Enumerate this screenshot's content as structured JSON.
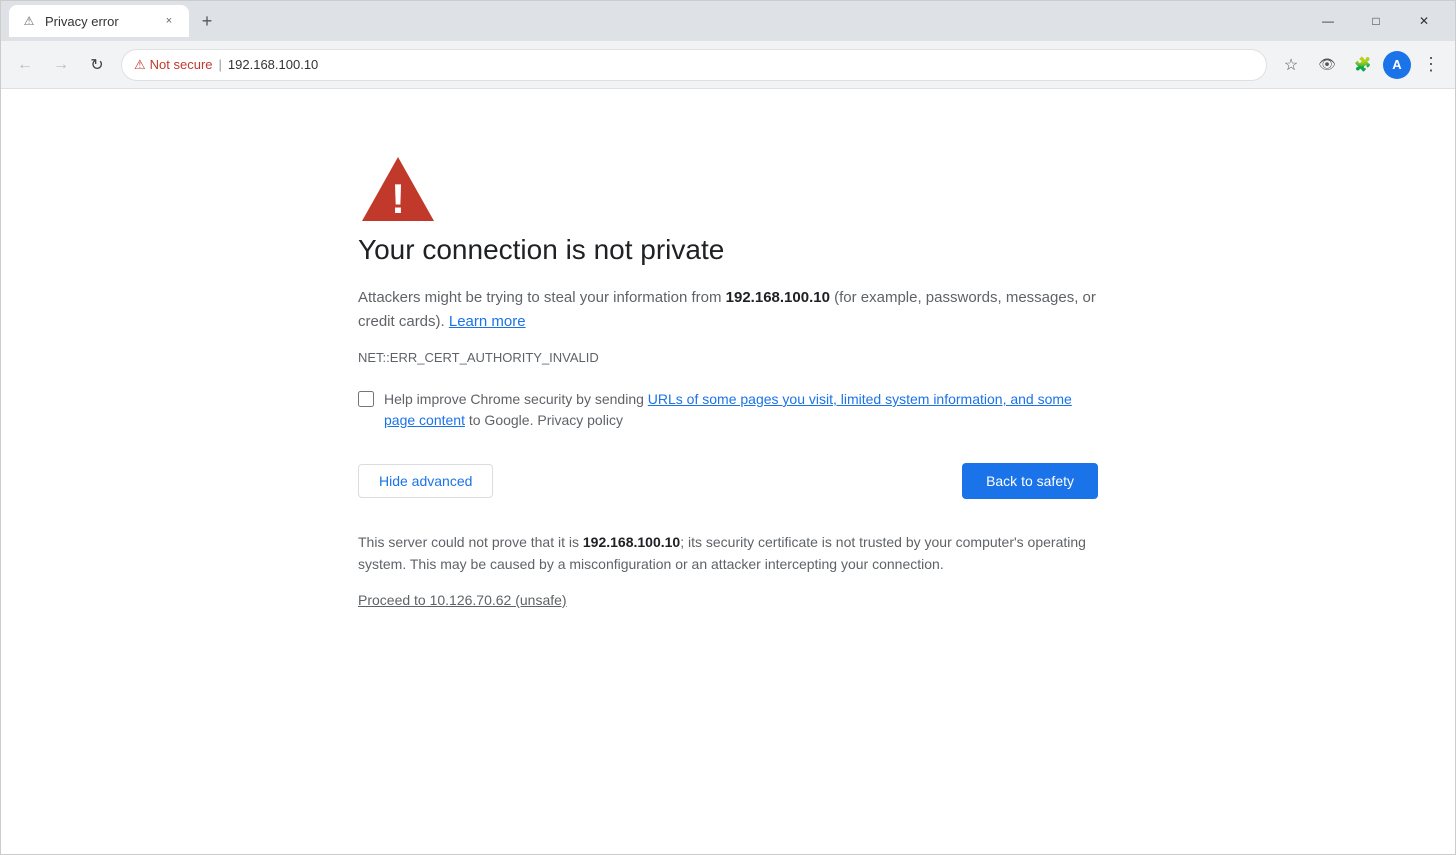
{
  "browser": {
    "tab": {
      "favicon": "⚠",
      "title": "Privacy error",
      "close_label": "×"
    },
    "new_tab_label": "+",
    "window_controls": {
      "minimize": "—",
      "maximize": "□",
      "close": "✕"
    },
    "nav": {
      "back_label": "←",
      "forward_label": "→",
      "reload_label": "↻",
      "not_secure_label": "Not secure",
      "address_separator": "|",
      "url": "192.168.100.10"
    }
  },
  "page": {
    "error_title": "Your connection is not private",
    "description_part1": "Attackers might be trying to steal your information from ",
    "description_ip": "192.168.100.10",
    "description_part2": " (for example, passwords, messages, or credit cards). ",
    "learn_more_label": "Learn more",
    "error_code": "NET::ERR_CERT_AUTHORITY_INVALID",
    "checkbox_text_part1": "Help improve Chrome security by sending ",
    "checkbox_link": "URLs of some pages you visit, limited system information, and some page content",
    "checkbox_text_part2": " to Google. ",
    "privacy_policy_label": "Privacy policy",
    "hide_advanced_label": "Hide advanced",
    "back_to_safety_label": "Back to safety",
    "advanced_text_part1": "This server could not prove that it is ",
    "advanced_text_ip": "192.168.100.10",
    "advanced_text_part2": "; its security certificate is not trusted by your computer's operating system. This may be caused by a misconfiguration or an attacker intercepting your connection.",
    "proceed_link_label": "Proceed to 10.126.70.62 (unsafe)"
  }
}
